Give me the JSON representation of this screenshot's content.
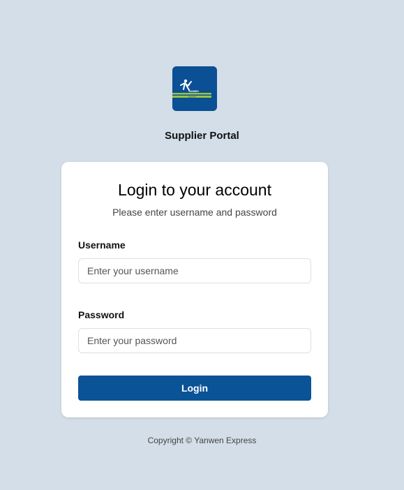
{
  "header": {
    "logo_icon": "yanwen-logo-icon",
    "logo_text_line1": "YANWEN",
    "logo_text_line2": "Express",
    "portal_title": "Supplier Portal"
  },
  "login_card": {
    "title": "Login to your account",
    "subtitle": "Please enter username and password",
    "username": {
      "label": "Username",
      "placeholder": "Enter your username",
      "value": ""
    },
    "password": {
      "label": "Password",
      "placeholder": "Enter your password",
      "value": ""
    },
    "login_button_label": "Login"
  },
  "footer": {
    "copyright": "Copyright © Yanwen Express"
  },
  "colors": {
    "background": "#d3dee8",
    "brand_blue": "#0b5397",
    "logo_green": "#9bc53d"
  }
}
